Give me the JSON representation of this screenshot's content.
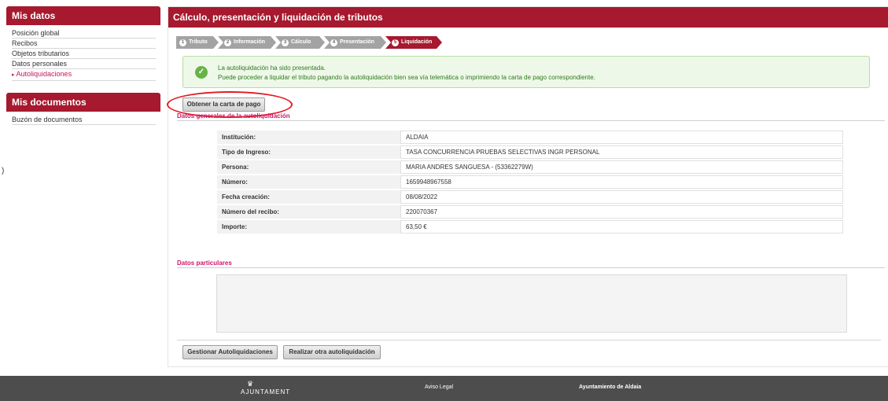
{
  "sidebar": {
    "mis_datos": {
      "title": "Mis datos",
      "items": [
        {
          "label": "Posición global"
        },
        {
          "label": "Recibos"
        },
        {
          "label": "Objetos tributarios"
        },
        {
          "label": "Datos personales"
        },
        {
          "label": "Autoliquidaciones"
        }
      ]
    },
    "mis_documentos": {
      "title": "Mis documentos",
      "items": [
        {
          "label": "Buzón de documentos"
        }
      ]
    }
  },
  "stray_char": ")",
  "main": {
    "title": "Cálculo, presentación y liquidación de tributos",
    "steps": [
      {
        "num": "1",
        "label": "Tributo"
      },
      {
        "num": "2",
        "label": "Información"
      },
      {
        "num": "3",
        "label": "Cálculo"
      },
      {
        "num": "4",
        "label": "Presentación"
      },
      {
        "num": "5",
        "label": "Liquidación"
      }
    ],
    "alert": {
      "line1": "La autoliquidación ha sido presentada.",
      "line2": "Puede proceder a liquidar el tributo pagando la autoliquidación bien sea vía telemática o imprimiendo la carta de pago correspondiente."
    },
    "carta_button": "Obtener la carta de pago",
    "section_general": "Datos generales de la autoliquidación",
    "details": [
      {
        "key": "Institución:",
        "value": "ALDAIA"
      },
      {
        "key": "Tipo de Ingreso:",
        "value": "TASA CONCURRENCIA PRUEBAS SELECTIVAS INGR PERSONAL"
      },
      {
        "key": "Persona:",
        "value": "MARIA ANDRES SANGUESA - (53362279W)"
      },
      {
        "key": "Número:",
        "value": "1659948967558"
      },
      {
        "key": "Fecha creación:",
        "value": "08/08/2022"
      },
      {
        "key": "Número del recibo:",
        "value": "220070367"
      },
      {
        "key": "Importe:",
        "value": "63,50 €"
      }
    ],
    "section_particulares": "Datos particulares",
    "gestionar_button": "Gestionar Autoliquidaciones",
    "otra_button": "Realizar otra autoliquidación"
  },
  "footer": {
    "logo_text": "AJUNTAMENT",
    "aviso": "Aviso Legal",
    "ayuntamiento": "Ayuntamiento de Aldaia"
  },
  "colors": {
    "brand": "#a6192e",
    "accent_pink": "#d1156a",
    "success": "#67b346",
    "highlight_ring": "#e11b22"
  }
}
